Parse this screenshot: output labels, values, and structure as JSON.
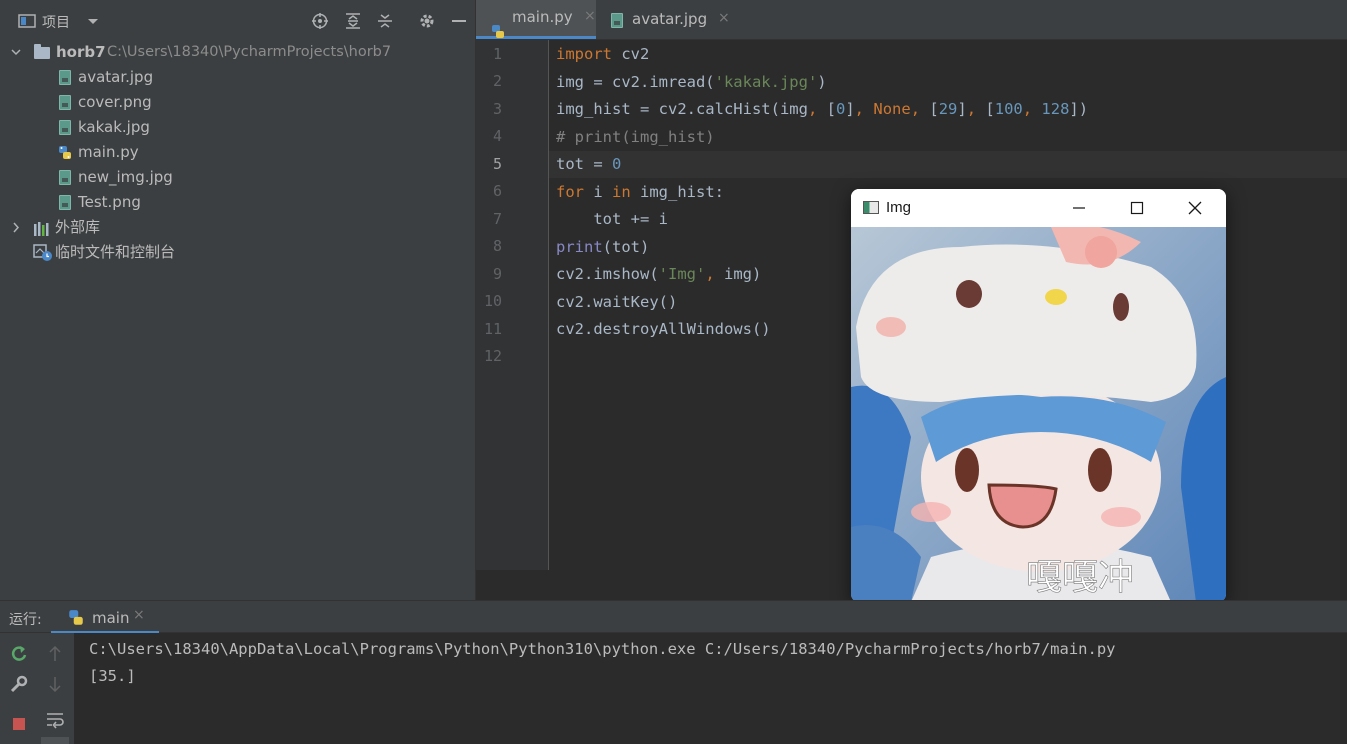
{
  "project_panel": {
    "title": "项目",
    "root": {
      "name": "horb7",
      "path": "C:\\Users\\18340\\PycharmProjects\\horb7"
    },
    "files": [
      "avatar.jpg",
      "cover.png",
      "kakak.jpg",
      "main.py",
      "new_img.jpg",
      "Test.png"
    ],
    "external_libs": "外部库",
    "scratches": "临时文件和控制台"
  },
  "editor": {
    "tabs": [
      {
        "label": "main.py",
        "icon": "python-file-icon",
        "active": true
      },
      {
        "label": "avatar.jpg",
        "icon": "image-file-icon",
        "active": false
      }
    ],
    "current_line": 5,
    "lines": [
      "import cv2",
      "img = cv2.imread('kakak.jpg')",
      "img_hist = cv2.calcHist(img, [0], None, [29], [100, 128])",
      "# print(img_hist)",
      "tot = 0",
      "for i in img_hist:",
      "    tot += i",
      "print(tot)",
      "cv2.imshow('Img', img)",
      "cv2.waitKey()",
      "cv2.destroyAllWindows()",
      ""
    ]
  },
  "img_window": {
    "title": "Img",
    "overlay_text": "嘎嘎冲"
  },
  "run_panel": {
    "label": "运行:",
    "tab": "main",
    "output": [
      "C:\\Users\\18340\\AppData\\Local\\Programs\\Python\\Python310\\python.exe C:/Users/18340/PycharmProjects/horb7/main.py",
      "[35.]"
    ]
  },
  "colors": {
    "accent": "#4a88c7",
    "keyword": "#cc7832",
    "string": "#6a8759",
    "number": "#6897bb",
    "comment": "#808080"
  }
}
